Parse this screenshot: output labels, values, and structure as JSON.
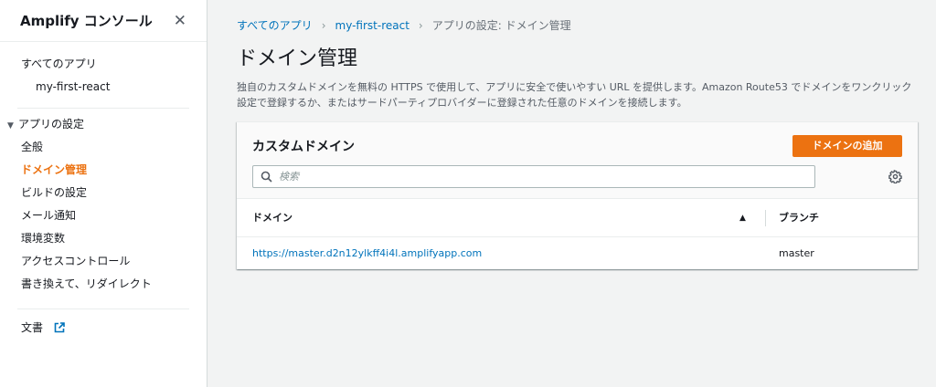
{
  "sidebar": {
    "title": "Amplify コンソール",
    "close_icon": "close-icon",
    "all_apps": "すべてのアプリ",
    "app_name": "my-first-react",
    "app_settings_group": "アプリの設定",
    "items": [
      {
        "label": "全般",
        "active": false
      },
      {
        "label": "ドメイン管理",
        "active": true
      },
      {
        "label": "ビルドの設定",
        "active": false
      },
      {
        "label": "メール通知",
        "active": false
      },
      {
        "label": "環境変数",
        "active": false
      },
      {
        "label": "アクセスコントロール",
        "active": false
      },
      {
        "label": "書き換えて、リダイレクト",
        "active": false
      }
    ],
    "docs": "文書",
    "docs_icon": "external-link-icon"
  },
  "breadcrumb": {
    "items": [
      "すべてのアプリ",
      "my-first-react"
    ],
    "current": "アプリの設定: ドメイン管理"
  },
  "page": {
    "title": "ドメイン管理",
    "description": "独自のカスタムドメインを無料の HTTPS で使用して、アプリに安全で使いやすい URL を提供します。Amazon Route53 でドメインをワンクリック設定で登録するか、またはサードパーティプロバイダーに登録された任意のドメインを接続します。"
  },
  "panel": {
    "title": "カスタムドメイン",
    "add_button": "ドメインの追加",
    "search_placeholder": "検索",
    "columns": [
      "ドメイン",
      "ブランチ"
    ],
    "sort_indicator": "▲",
    "rows": [
      {
        "domain": "https://master.d2n12ylkff4i4l.amplifyapp.com",
        "branch": "master"
      }
    ]
  },
  "colors": {
    "accent": "#ec7211",
    "link": "#0073bb"
  }
}
